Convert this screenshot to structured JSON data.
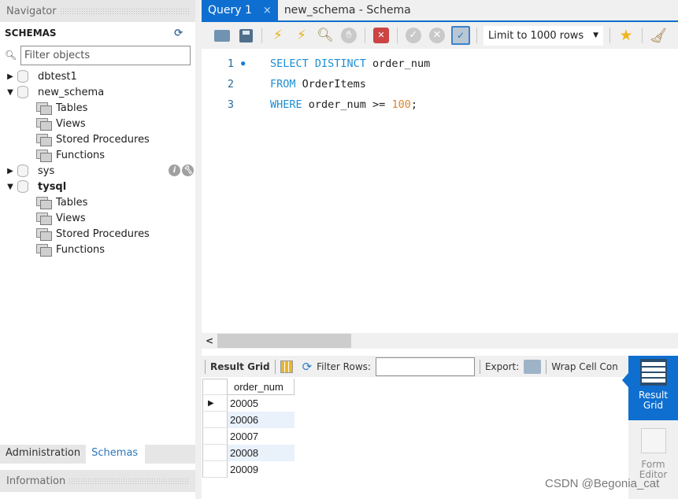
{
  "navigator": {
    "header": "Navigator",
    "section_title": "SCHEMAS",
    "filter_placeholder": "Filter objects",
    "schemas": [
      {
        "name": "dbtest1",
        "expanded": false,
        "bold": false,
        "children": []
      },
      {
        "name": "new_schema",
        "expanded": true,
        "bold": false,
        "children": [
          "Tables",
          "Views",
          "Stored Procedures",
          "Functions"
        ]
      },
      {
        "name": "sys",
        "expanded": false,
        "bold": false,
        "children": []
      },
      {
        "name": "tysql",
        "expanded": true,
        "bold": true,
        "children": [
          "Tables",
          "Views",
          "Stored Procedures",
          "Functions"
        ]
      }
    ],
    "bottom_tabs": [
      "Administration",
      "Schemas"
    ],
    "active_bottom_tab": "Schemas",
    "info_header": "Information"
  },
  "tabs": [
    {
      "label": "Query 1",
      "active": true,
      "close": "×"
    },
    {
      "label": "new_schema - Schema",
      "active": false
    }
  ],
  "toolbar": {
    "limit_select": "Limit to 1000 rows"
  },
  "editor": {
    "lines": [
      {
        "num": "1",
        "bullet": "●",
        "tokens": [
          {
            "t": "SELECT DISTINCT ",
            "c": "kw"
          },
          {
            "t": "order_num",
            "c": ""
          }
        ]
      },
      {
        "num": "2",
        "bullet": "",
        "tokens": [
          {
            "t": "FROM ",
            "c": "kw"
          },
          {
            "t": "OrderItems",
            "c": ""
          }
        ]
      },
      {
        "num": "3",
        "bullet": "",
        "tokens": [
          {
            "t": "WHERE ",
            "c": "kw"
          },
          {
            "t": "order_num >= ",
            "c": ""
          },
          {
            "t": "100",
            "c": "num"
          },
          {
            "t": ";",
            "c": ""
          }
        ]
      }
    ]
  },
  "result_toolbar": {
    "result_grid_label": "Result Grid",
    "filter_rows_label": "Filter Rows:",
    "filter_rows_value": "",
    "export_label": "Export:",
    "wrap_label": "Wrap Cell Con"
  },
  "grid": {
    "columns": [
      "order_num"
    ],
    "rows": [
      "20005",
      "20006",
      "20007",
      "20008",
      "20009"
    ],
    "selected_row_marker": "▶"
  },
  "side_panel": {
    "result_grid": "Result\nGrid",
    "result_grid_lines": [
      "Result",
      "Grid"
    ],
    "form_editor_lines": [
      "Form",
      "Editor"
    ]
  },
  "watermark": "CSDN @Begonia_cat"
}
